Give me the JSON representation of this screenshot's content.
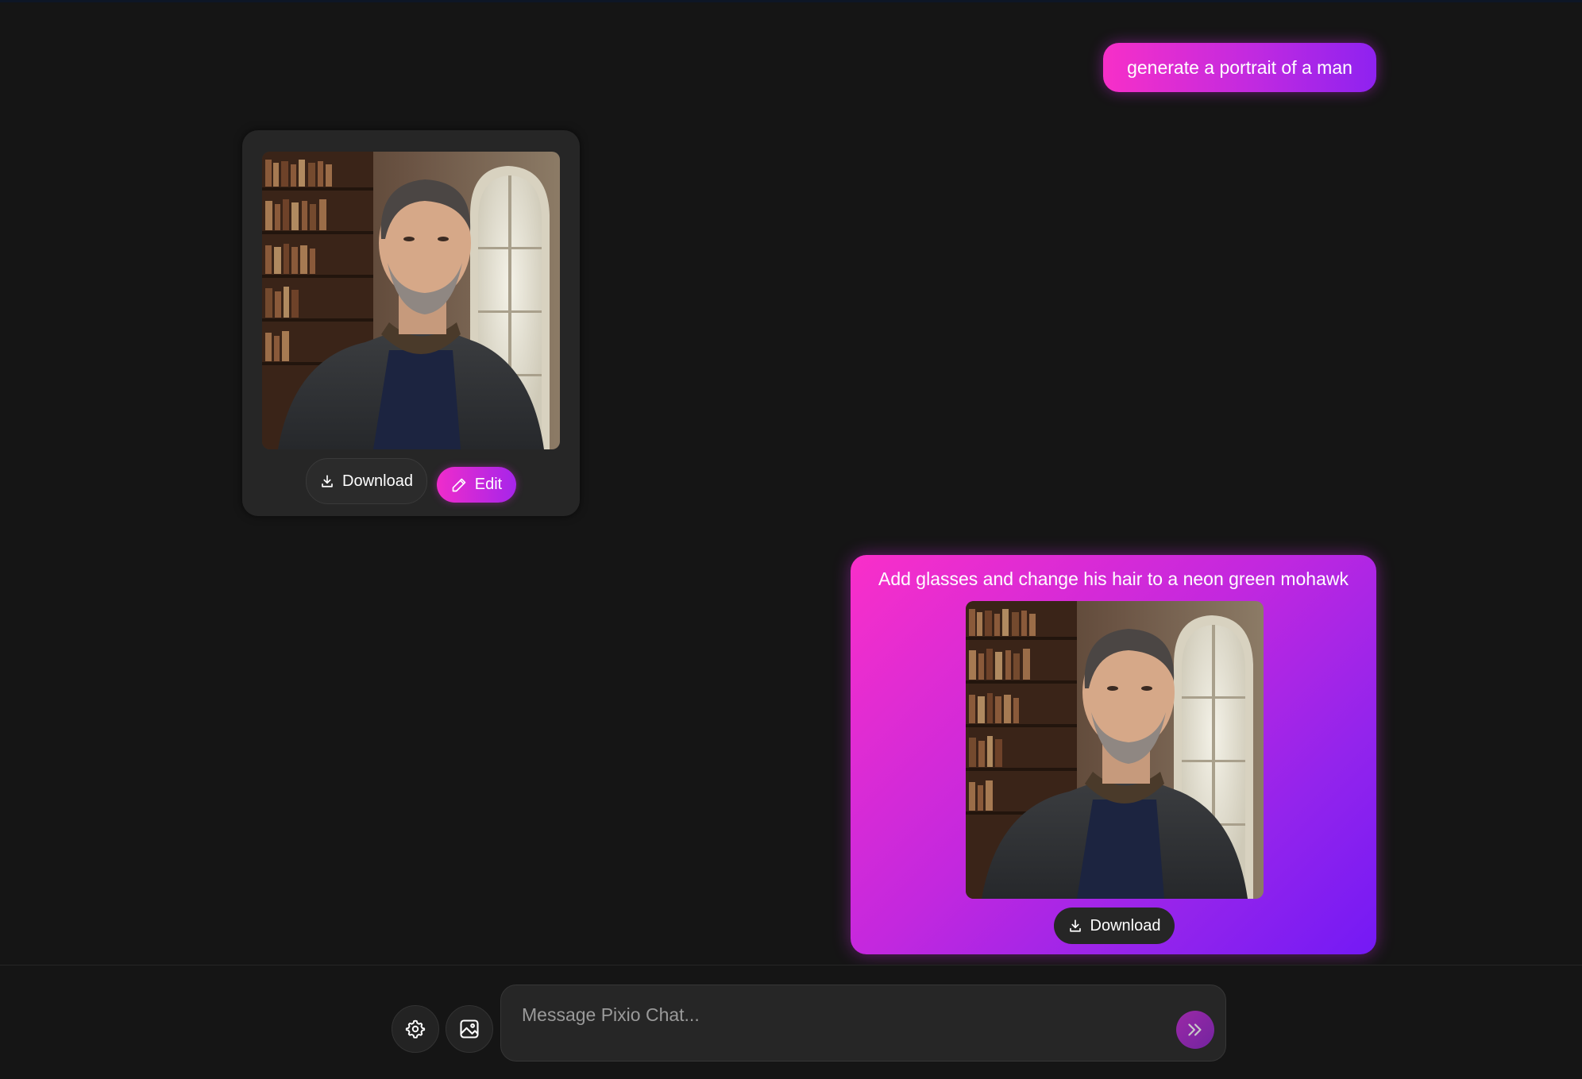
{
  "app": {
    "name": "Pixio Chat"
  },
  "messages": {
    "first_prompt": "generate a portrait of a man",
    "assistant_card": {
      "download_label": "Download",
      "edit_label": "Edit"
    },
    "edit_prompt": {
      "text": "Add glasses and change his hair to a neon green mohawk",
      "download_label": "Download"
    }
  },
  "composer": {
    "placeholder": "Message Pixio Chat...",
    "value": ""
  },
  "colors": {
    "background": "#151515",
    "card": "#262626",
    "accent_pink": "#f72fc8",
    "accent_purple": "#7419f5"
  },
  "icons": {
    "download": "download-icon",
    "edit": "pencil-icon",
    "settings": "gear-icon",
    "image": "image-icon",
    "send": "double-chevron-right-icon"
  }
}
